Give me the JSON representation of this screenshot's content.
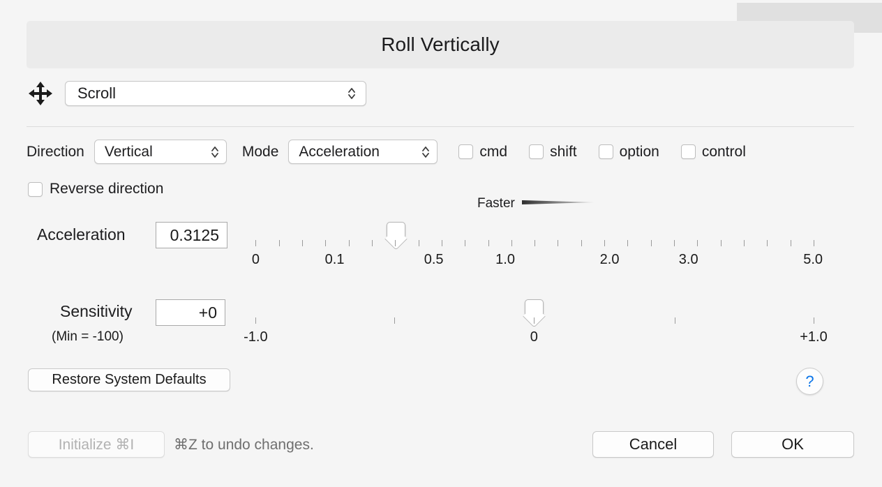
{
  "window": {
    "title": "Roll Vertically"
  },
  "action": {
    "icon": "move-arrows-icon",
    "value": "Scroll"
  },
  "settings": {
    "direction_label": "Direction",
    "direction_value": "Vertical",
    "mode_label": "Mode",
    "mode_value": "Acceleration",
    "modifiers": [
      {
        "label": "cmd",
        "checked": false
      },
      {
        "label": "shift",
        "checked": false
      },
      {
        "label": "option",
        "checked": false
      },
      {
        "label": "control",
        "checked": false
      }
    ],
    "reverse_direction_label": "Reverse direction",
    "reverse_direction_checked": false
  },
  "acceleration": {
    "label": "Acceleration",
    "value": "0.3125",
    "faster_label": "Faster",
    "thumb_percent": 25.8,
    "tick_count": 25,
    "tick_labels": [
      {
        "text": "0",
        "percent": 1.5
      },
      {
        "text": "0.1",
        "percent": 15.2
      },
      {
        "text": "0.5",
        "percent": 32.4
      },
      {
        "text": "1.0",
        "percent": 44.8
      },
      {
        "text": "2.0",
        "percent": 62.9
      },
      {
        "text": "3.0",
        "percent": 76.6
      },
      {
        "text": "5.0",
        "percent": 98.2
      }
    ]
  },
  "sensitivity": {
    "label": "Sensitivity",
    "value": "+0",
    "min_note": "(Min = -100)",
    "thumb_percent": 49.8,
    "ticks": [
      {
        "percent": 1.5,
        "label": "-1.0"
      },
      {
        "percent": 25.6,
        "label": ""
      },
      {
        "percent": 49.8,
        "label": "0"
      },
      {
        "percent": 74.2,
        "label": ""
      },
      {
        "percent": 98.3,
        "label": "+1.0"
      }
    ]
  },
  "footer": {
    "restore_label": "Restore System Defaults",
    "help_label": "?",
    "initialize_label": "Initialize ⌘I",
    "undo_hint": "⌘Z to undo changes.",
    "cancel_label": "Cancel",
    "ok_label": "OK"
  },
  "colors": {
    "background": "#f5f5f5",
    "header_bg": "#ebebeb",
    "track": "#b8b8b8",
    "accent_blue": "#0a74e8",
    "disabled_text": "#b2b2b2"
  }
}
